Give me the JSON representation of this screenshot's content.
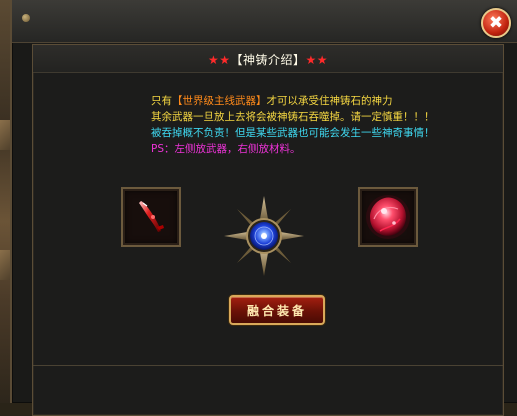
{
  "window": {
    "title_star_left": "★★",
    "title_text": "【神铸介绍】",
    "title_star_right": "★★",
    "close_glyph": "✖"
  },
  "description": {
    "line1_prefix": "只有",
    "line1_highlight": "【世界级主线武器】",
    "line1_suffix": "才可以承受住神铸石的神力",
    "line2": "其余武器一旦放上去将会被神铸石吞噬掉。请一定慎重！！！",
    "line3": "被吞掉概不负责！但是某些武器也可能会发生一些神奇事情！",
    "line4": "PS：左侧放武器，右侧放材料。"
  },
  "slots": {
    "left_slot_item": "red-blade-weapon-icon",
    "center_item": "blue-orb-compass-icon",
    "right_slot_item": "red-crystal-orb-icon"
  },
  "actions": {
    "fuse_label": "融合装备"
  },
  "colors": {
    "text_yellow": "#f5d742",
    "highlight_orange": "#ff8a1a",
    "text_cyan": "#3fd8f0",
    "text_magenta": "#ee33d8",
    "title_star_red": "#ff2a2a",
    "button_red": "#a41f10",
    "frame_gold": "#d9a95a"
  }
}
